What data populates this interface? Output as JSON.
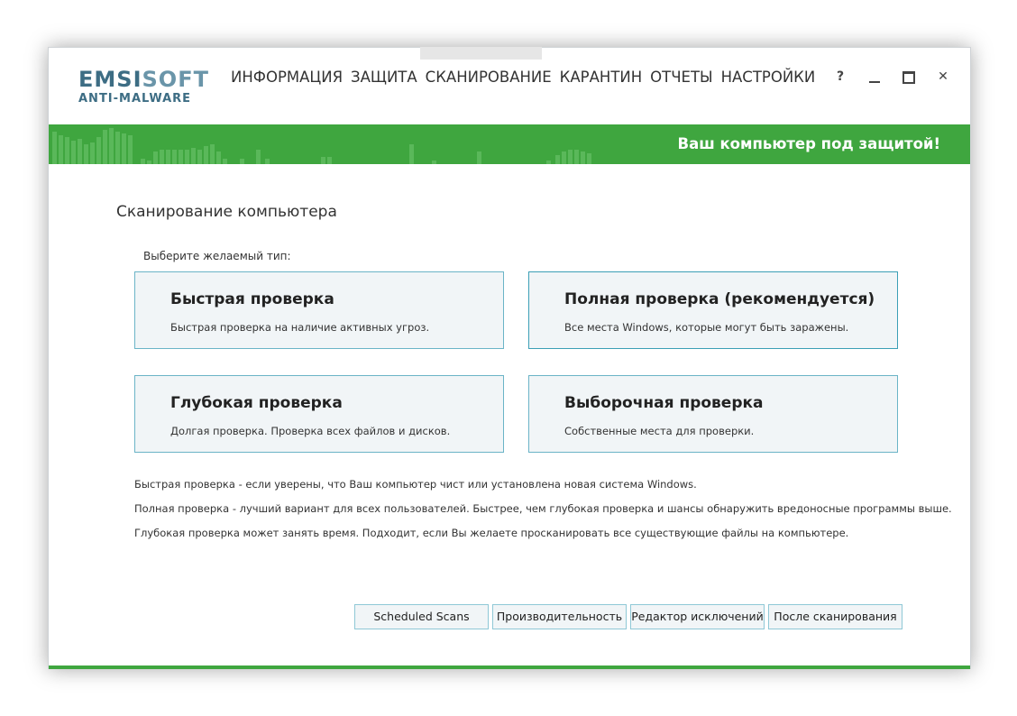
{
  "window": {
    "logo": {
      "brand_strong": "EMSI",
      "brand_light": "SOFT",
      "subtitle": "ANTI-MALWARE"
    },
    "nav": [
      "ИНФОРМАЦИЯ",
      "ЗАЩИТА",
      "СКАНИРОВАНИЕ",
      "КАРАНТИН",
      "ОТЧЕТЫ",
      "НАСТРОЙКИ"
    ],
    "controls": {
      "help": "?",
      "close": "✕"
    }
  },
  "status": {
    "text": "Ваш компьютер под защитой!",
    "color": "#3fa63f"
  },
  "page": {
    "title": "Сканирование компьютера",
    "hint": "Выберите желаемый тип:"
  },
  "scan_types": [
    {
      "title": "Быстрая проверка",
      "desc": "Быстрая проверка на наличие активных угроз."
    },
    {
      "title": "Полная проверка (рекомендуется)",
      "desc": "Все места Windows, которые могут быть заражены."
    },
    {
      "title": "Глубокая проверка",
      "desc": "Долгая проверка. Проверка всех файлов и дисков."
    },
    {
      "title": "Выборочная проверка",
      "desc": "Собственные места для проверки."
    }
  ],
  "descriptions": [
    "Быстрая проверка - если уверены, что Ваш компьютер чист или установлена новая система Windows.",
    "Полная проверка - лучший вариант для всех пользователей. Быстрее, чем глубокая проверка и шансы обнаружить вредоносные программы выше.",
    "Глубокая проверка может занять время. Подходит, если Вы желаете просканировать все существующие файлы на компьютере."
  ],
  "buttons": {
    "scheduled": "Scheduled Scans",
    "performance": "Производительность",
    "exclusions": "Редактор исключений",
    "after_scan": "После сканирования"
  }
}
